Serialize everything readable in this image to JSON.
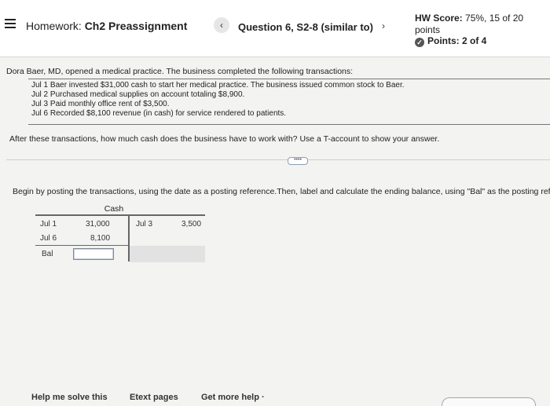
{
  "header": {
    "title_prefix": "Homework: ",
    "title": "Ch2 Preassignment",
    "question": "Question 6, S2-8 (similar to)",
    "prev_glyph": "‹",
    "next_glyph": "›",
    "hw_score_label": "HW Score: ",
    "hw_score_value": "75%, 15 of 20",
    "hw_score_unit": "points",
    "points_label": "Points: ",
    "points_value": "2 of 4"
  },
  "problem": {
    "intro": "Dora Baer, MD, opened a medical practice. The business completed the following transactions:",
    "transactions": [
      "Jul 1  Baer invested $31,000 cash to start her medical practice. The business issued common stock to Baer.",
      "Jul 2  Purchased medical supplies on account totaling $8,900.",
      "Jul 3  Paid monthly office rent of $3,500.",
      "Jul 6  Recorded $8,100 revenue (in cash) for service rendered to patients."
    ],
    "question": "After these transactions, how much cash does the business have to work with? Use a T-account to show your answer.",
    "more_label": "••••",
    "instructions": "Begin by posting the transactions, using the date as a posting reference.Then, label and calculate the ending balance, using \"Bal\" as the posting reference"
  },
  "taccount": {
    "title": "Cash",
    "debits": [
      {
        "ref": "Jul 1",
        "amount": "31,000"
      },
      {
        "ref": "Jul 6",
        "amount": "8,100"
      }
    ],
    "credits": [
      {
        "ref": "Jul 3",
        "amount": "3,500"
      }
    ],
    "balance_label": "Bal",
    "balance_value": ""
  },
  "footer": {
    "help": "Help me solve this",
    "etext": "Etext pages",
    "more_help": "Get more help ·"
  }
}
